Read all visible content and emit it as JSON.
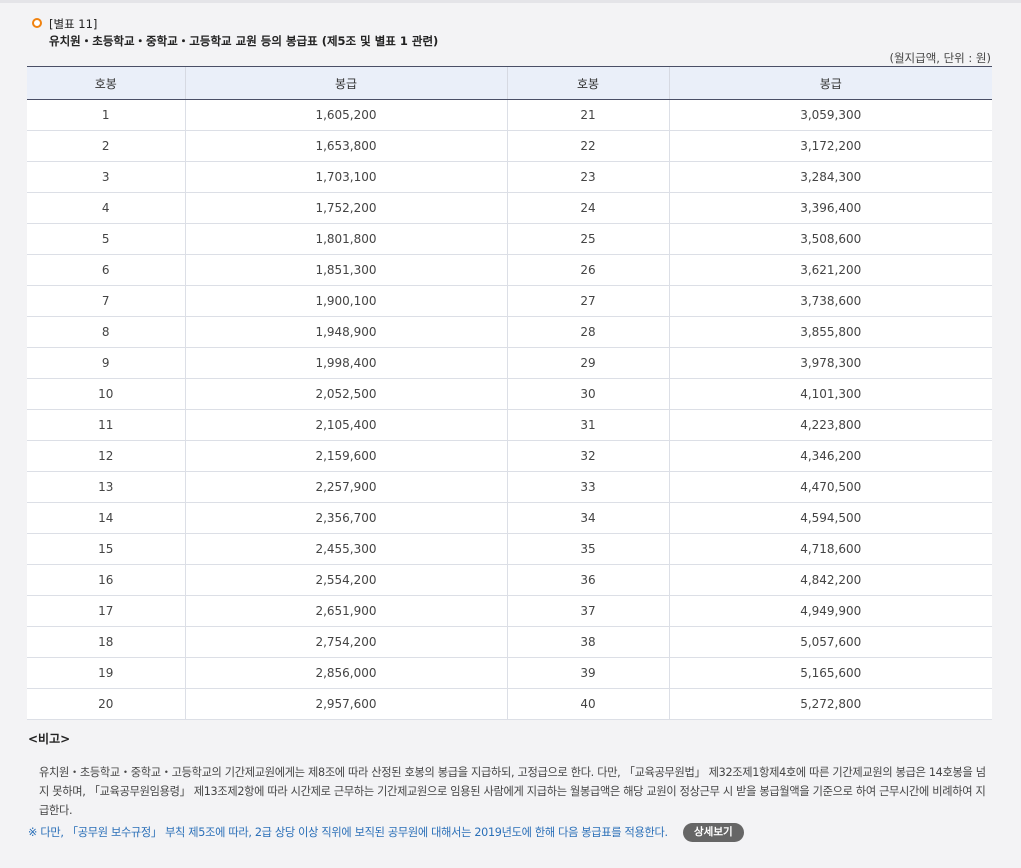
{
  "caption": {
    "code": "[별표 11]",
    "title": "유치원・초등학교・중학교・고등학교 교원 등의 봉급표 (제5조 및 별표 1 관련)"
  },
  "unit_note": "(월지급액, 단위 : 원)",
  "table": {
    "headers": [
      "호봉",
      "봉급",
      "호봉",
      "봉급"
    ],
    "rows": [
      [
        "1",
        "1,605,200",
        "21",
        "3,059,300"
      ],
      [
        "2",
        "1,653,800",
        "22",
        "3,172,200"
      ],
      [
        "3",
        "1,703,100",
        "23",
        "3,284,300"
      ],
      [
        "4",
        "1,752,200",
        "24",
        "3,396,400"
      ],
      [
        "5",
        "1,801,800",
        "25",
        "3,508,600"
      ],
      [
        "6",
        "1,851,300",
        "26",
        "3,621,200"
      ],
      [
        "7",
        "1,900,100",
        "27",
        "3,738,600"
      ],
      [
        "8",
        "1,948,900",
        "28",
        "3,855,800"
      ],
      [
        "9",
        "1,998,400",
        "29",
        "3,978,300"
      ],
      [
        "10",
        "2,052,500",
        "30",
        "4,101,300"
      ],
      [
        "11",
        "2,105,400",
        "31",
        "4,223,800"
      ],
      [
        "12",
        "2,159,600",
        "32",
        "4,346,200"
      ],
      [
        "13",
        "2,257,900",
        "33",
        "4,470,500"
      ],
      [
        "14",
        "2,356,700",
        "34",
        "4,594,500"
      ],
      [
        "15",
        "2,455,300",
        "35",
        "4,718,600"
      ],
      [
        "16",
        "2,554,200",
        "36",
        "4,842,200"
      ],
      [
        "17",
        "2,651,900",
        "37",
        "4,949,900"
      ],
      [
        "18",
        "2,754,200",
        "38",
        "5,057,600"
      ],
      [
        "19",
        "2,856,000",
        "39",
        "5,165,600"
      ],
      [
        "20",
        "2,957,600",
        "40",
        "5,272,800"
      ]
    ]
  },
  "remarks": {
    "title": "<비고>",
    "body": "유치원・초등학교・중학교・고등학교의 기간제교원에게는 제8조에 따라 산정된 호봉의 봉급을 지급하되, 고정급으로 한다. 다만, 「교육공무원법」 제32조제1항제4호에 따른 기간제교원의 봉급은 14호봉을 넘지 못하며, 「교육공무원임용령」 제13조제2항에 따라 시간제로 근무하는 기간제교원으로 임용된 사람에게 지급하는 월봉급액은 해당 교원이 정상근무 시 받을 봉급월액을 기준으로 하여 근무시간에 비례하여 지급한다."
  },
  "note": "※ 다만, 「공무원 보수규정」 부칙 제5조에 따라, 2급 상당 이상 직위에 보직된 공무원에 대해서는 2019년도에 한해 다음 봉급표를 적용한다.",
  "detail_button": "상세보기",
  "colors": {
    "accent_ring": "#f0820f",
    "header_bg": "#eaeff9",
    "note_text": "#2a6fb8",
    "button_bg": "#666666"
  }
}
